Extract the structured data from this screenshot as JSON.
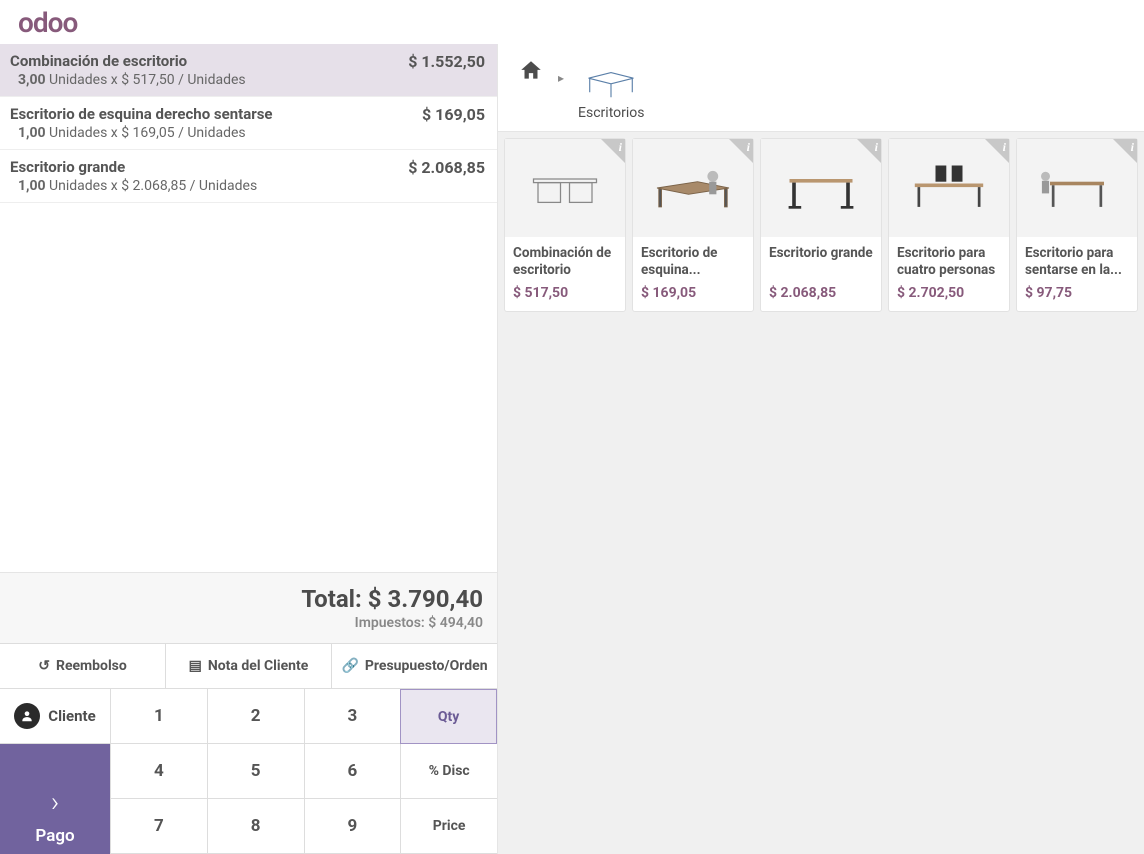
{
  "brand": "odoo",
  "order_lines": [
    {
      "name": "Combinación de escritorio",
      "qty": "3,00",
      "unit_text": "Unidades x $ 517,50 / Unidades",
      "total": "$ 1.552,50",
      "selected": true
    },
    {
      "name": "Escritorio de esquina derecho sentarse",
      "qty": "1,00",
      "unit_text": "Unidades x $ 169,05 / Unidades",
      "total": "$ 169,05",
      "selected": false
    },
    {
      "name": "Escritorio grande",
      "qty": "1,00",
      "unit_text": "Unidades x $ 2.068,85 / Unidades",
      "total": "$ 2.068,85",
      "selected": false
    }
  ],
  "totals": {
    "total_label": "Total:",
    "total_value": "$ 3.790,40",
    "tax_label": "Impuestos:",
    "tax_value": "$ 494,40"
  },
  "actions": {
    "refund": "Reembolso",
    "note": "Nota del Cliente",
    "quote": "Presupuesto/Orden"
  },
  "customer_button": "Cliente",
  "pay_button": "Pago",
  "keypad": {
    "r1": [
      "1",
      "2",
      "3"
    ],
    "r2": [
      "4",
      "5",
      "6"
    ],
    "r3": [
      "7",
      "8",
      "9"
    ],
    "modes": [
      "Qty",
      "% Disc",
      "Price"
    ]
  },
  "breadcrumb": {
    "category": "Escritorios"
  },
  "products": [
    {
      "name": "Combinación de escritorio",
      "price": "$ 517,50"
    },
    {
      "name": "Escritorio de esquina...",
      "price": "$ 169,05"
    },
    {
      "name": "Escritorio grande",
      "price": "$ 2.068,85"
    },
    {
      "name": "Escritorio para cuatro personas",
      "price": "$ 2.702,50"
    },
    {
      "name": "Escritorio para sentarse en la...",
      "price": "$ 97,75"
    }
  ]
}
